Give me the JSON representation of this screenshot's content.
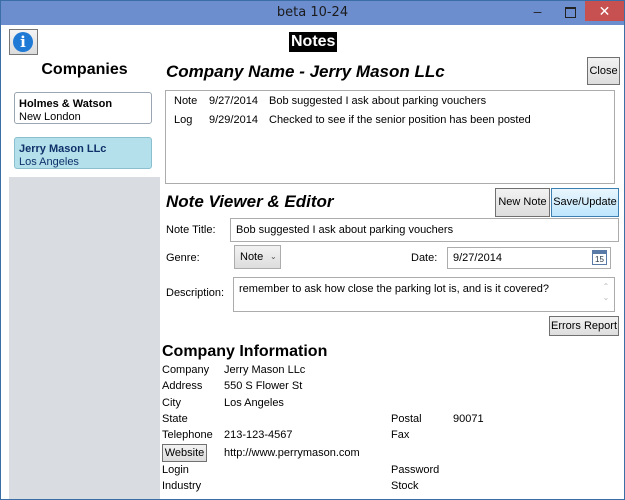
{
  "window": {
    "title": "beta 10-24",
    "min_glyph": "–",
    "close_glyph": "✕"
  },
  "header": {
    "info_glyph": "i",
    "title": "Notes"
  },
  "sidebar": {
    "heading": "Companies",
    "items": [
      {
        "name": "Holmes & Watson",
        "city": "New London"
      },
      {
        "name": "Jerry Mason LLc",
        "city": "Los Angeles"
      }
    ]
  },
  "main": {
    "company_name": "Company Name - Jerry Mason LLc",
    "close_label": "Close",
    "log": [
      {
        "type": "Note",
        "date": "9/27/2014",
        "text": "Bob suggested I ask about parking vouchers"
      },
      {
        "type": "Log",
        "date": "9/29/2014",
        "text": "Checked to see if the senior position has been posted"
      }
    ]
  },
  "editor": {
    "heading": "Note Viewer & Editor",
    "new_note_label": "New Note",
    "save_label": "Save/Update",
    "title_label": "Note Title:",
    "title_value": "Bob suggested I ask about parking vouchers",
    "genre_label": "Genre:",
    "genre_value": "Note",
    "date_label": "Date:",
    "date_value": "9/27/2014",
    "calendar_day": "15",
    "description_label": "Description:",
    "description_value": "remember to ask how close the parking lot is, and is it covered?",
    "errors_label": "Errors Report"
  },
  "info": {
    "heading": "Company Information",
    "company_label": "Company",
    "company_value": "Jerry Mason LLc",
    "address_label": "Address",
    "address_value": "550 S Flower St",
    "city_label": "City",
    "city_value": "Los Angeles",
    "state_label": "State",
    "state_value": "",
    "postal_label": "Postal",
    "postal_value": "90071",
    "telephone_label": "Telephone",
    "telephone_value": "213-123-4567",
    "fax_label": "Fax",
    "fax_value": "",
    "website_label": "Website",
    "website_value": "http://www.perrymason.com",
    "login_label": "Login",
    "password_label": "Password",
    "industry_label": "Industry",
    "stock_label": "Stock"
  }
}
